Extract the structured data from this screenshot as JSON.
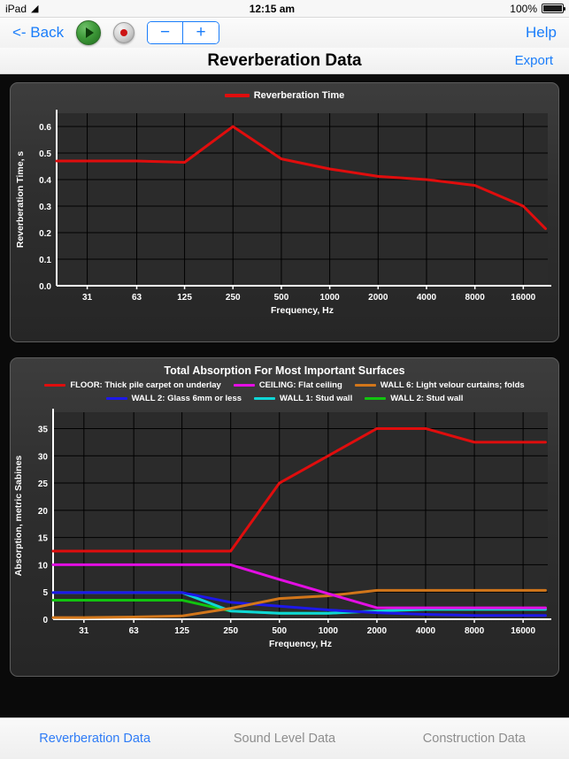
{
  "statusbar": {
    "device": "iPad",
    "wifi_icon": "wifi-icon",
    "time": "12:15 am",
    "bluetooth_icon": "bluetooth-icon",
    "battery_text": "100%",
    "battery_level": 100
  },
  "toolbar": {
    "back_label": "<- Back",
    "play_icon": "play-icon",
    "record_icon": "record-icon",
    "minus_label": "−",
    "plus_label": "+",
    "help_label": "Help"
  },
  "titlebar": {
    "title": "Reverberation Data",
    "export_label": "Export"
  },
  "tabs": [
    {
      "label": "Reverberation Data",
      "active": true
    },
    {
      "label": "Sound Level Data",
      "active": false
    },
    {
      "label": "Construction Data",
      "active": false
    }
  ],
  "colors": {
    "accent_blue": "#1a7dfa",
    "tab_active": "#2f7cf6",
    "tab_inactive": "#8e8e8e",
    "panel_bg": "#333333",
    "plot_bg": "#2b2b2b",
    "grid": "#000000",
    "axis": "#ffffff",
    "series_red": "#e00d0d",
    "series_magenta": "#e40ee4",
    "series_orange": "#d2761a",
    "series_blue": "#1d18e8",
    "series_cyan": "#0fd6d6",
    "series_green": "#11c40f"
  },
  "chart_data": [
    {
      "type": "line",
      "title": "",
      "legend": [
        {
          "name": "Reverberation Time",
          "color": "#e00d0d"
        }
      ],
      "legend_position": "top-center",
      "xlabel": "Frequency, Hz",
      "ylabel": "Reverberation Time, s",
      "x_tick_labels": [
        "31",
        "63",
        "125",
        "250",
        "500",
        "1000",
        "2000",
        "4000",
        "8000",
        "16000"
      ],
      "x_scale": "log",
      "y_tick_labels": [
        "0.0",
        "0.1",
        "0.2",
        "0.3",
        "0.4",
        "0.5",
        "0.6"
      ],
      "ylim": [
        0.0,
        0.65
      ],
      "grid": true,
      "series": [
        {
          "name": "Reverberation Time",
          "color": "#e00d0d",
          "x": [
            20,
            31,
            63,
            125,
            250,
            500,
            1000,
            2000,
            4000,
            8000,
            16000,
            22000
          ],
          "values": [
            0.47,
            0.47,
            0.47,
            0.465,
            0.6,
            0.478,
            0.44,
            0.412,
            0.4,
            0.378,
            0.3,
            0.215
          ]
        }
      ]
    },
    {
      "type": "line",
      "title": "Total Absorption For Most Important Surfaces",
      "legend": [
        {
          "name": "FLOOR: Thick pile carpet on underlay",
          "color": "#e00d0d"
        },
        {
          "name": "CEILING: Flat ceiling",
          "color": "#e40ee4"
        },
        {
          "name": "WALL 6: Light velour curtains; folds",
          "color": "#d2761a"
        },
        {
          "name": "WALL 2: Glass 6mm or less",
          "color": "#1d18e8"
        },
        {
          "name": "WALL 1: Stud wall",
          "color": "#0fd6d6"
        },
        {
          "name": "WALL 2: Stud wall",
          "color": "#11c40f"
        }
      ],
      "legend_position": "top-center",
      "xlabel": "Frequency, Hz",
      "ylabel": "Absorption, metric Sabines",
      "x_tick_labels": [
        "31",
        "63",
        "125",
        "250",
        "500",
        "1000",
        "2000",
        "4000",
        "8000",
        "16000"
      ],
      "x_scale": "log",
      "y_tick_labels": [
        "0",
        "5",
        "10",
        "15",
        "20",
        "25",
        "30",
        "35"
      ],
      "ylim": [
        0,
        38
      ],
      "grid": true,
      "series": [
        {
          "name": "FLOOR: Thick pile carpet on underlay",
          "color": "#e00d0d",
          "x": [
            20,
            31,
            63,
            125,
            250,
            500,
            1000,
            2000,
            4000,
            8000,
            16000,
            22000
          ],
          "values": [
            12.5,
            12.5,
            12.5,
            12.5,
            12.5,
            25.0,
            30.0,
            35.0,
            35.0,
            32.5,
            32.5,
            32.5
          ]
        },
        {
          "name": "CEILING: Flat ceiling",
          "color": "#e40ee4",
          "x": [
            20,
            31,
            63,
            125,
            250,
            500,
            1000,
            2000,
            4000,
            8000,
            16000,
            22000
          ],
          "values": [
            10.0,
            10.0,
            10.0,
            10.0,
            10.0,
            7.3,
            4.7,
            2.1,
            2.1,
            2.1,
            2.1,
            2.1
          ]
        },
        {
          "name": "WALL 6: Light velour curtains; folds",
          "color": "#d2761a",
          "x": [
            20,
            31,
            63,
            125,
            250,
            500,
            1000,
            2000,
            4000,
            8000,
            16000,
            22000
          ],
          "values": [
            0.3,
            0.3,
            0.4,
            0.6,
            2.0,
            3.8,
            4.3,
            5.3,
            5.3,
            5.3,
            5.3,
            5.3
          ]
        },
        {
          "name": "WALL 2: Glass 6mm or less",
          "color": "#1d18e8",
          "x": [
            20,
            31,
            63,
            125,
            250,
            500,
            1000,
            2000,
            4000,
            8000,
            16000,
            22000
          ],
          "values": [
            4.9,
            4.9,
            4.9,
            4.9,
            3.1,
            2.4,
            1.7,
            1.2,
            0.9,
            0.7,
            0.7,
            0.7
          ]
        },
        {
          "name": "WALL 1: Stud wall",
          "color": "#0fd6d6",
          "x": [
            20,
            31,
            63,
            125,
            250,
            500,
            1000,
            2000,
            4000,
            8000,
            16000,
            22000
          ],
          "values": [
            4.9,
            4.9,
            4.9,
            4.9,
            1.5,
            1.1,
            1.1,
            1.5,
            1.8,
            1.8,
            1.8,
            1.8
          ]
        },
        {
          "name": "WALL 2: Stud wall",
          "color": "#11c40f",
          "x": [
            20,
            31,
            63,
            125,
            250,
            500,
            1000,
            2000,
            4000,
            8000,
            16000,
            22000
          ],
          "values": [
            3.5,
            3.5,
            3.5,
            3.5,
            1.5,
            1.1,
            1.1,
            1.5,
            2.0,
            2.0,
            2.0,
            2.0
          ]
        }
      ]
    }
  ]
}
